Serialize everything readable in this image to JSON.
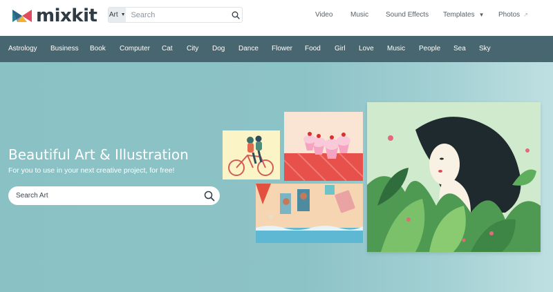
{
  "brand": {
    "name": "mixkit"
  },
  "header_search": {
    "category": "Art",
    "placeholder": "Search"
  },
  "top_nav": [
    {
      "label": "Video"
    },
    {
      "label": "Music"
    },
    {
      "label": "Sound Effects"
    },
    {
      "label": "Templates"
    },
    {
      "label": "Photos"
    }
  ],
  "categories": [
    "Astrology",
    "Business",
    "Book",
    "Computer",
    "Cat",
    "City",
    "Dog",
    "Dance",
    "Flower",
    "Food",
    "Girl",
    "Love",
    "Music",
    "People",
    "Sea",
    "Sky"
  ],
  "hero": {
    "title": "Beautiful Art & Illustration",
    "subtitle": "For you to use in your next creative project, for free!",
    "search_placeholder": "Search Art"
  },
  "colors": {
    "category_bar": "#486670",
    "hero_background": "#8cc3c7",
    "text_dark": "#2f3b45"
  },
  "icons": {
    "logo": "mixkit-logo-icon",
    "search": "search-icon",
    "dropdown": "caret-down-icon",
    "external": "external-link-icon"
  }
}
